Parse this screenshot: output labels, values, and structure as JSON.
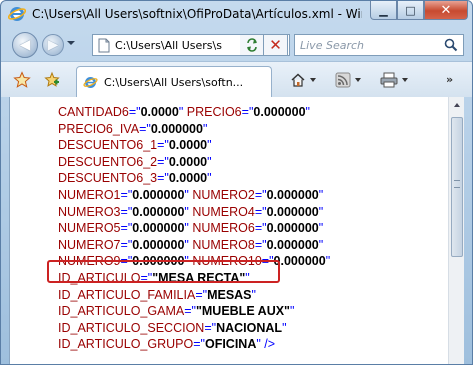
{
  "window": {
    "title": "C:\\Users\\All Users\\softnix\\OfiProData\\Artículos.xml - Windows...",
    "minimize": "▁",
    "maximize": "□",
    "close": "✕"
  },
  "nav": {
    "back": "◀",
    "forward": "▶",
    "address": "C:\\Users\\All Users\\s",
    "stop": "✕",
    "search_placeholder": "Live Search"
  },
  "tab": {
    "label": "C:\\Users\\All Users\\softn..."
  },
  "toolbar": {
    "chevron": "»"
  },
  "content": {
    "lines": [
      [
        {
          "t": "attr",
          "s": "CANTIDAD6"
        },
        {
          "t": "sym",
          "s": "=\""
        },
        {
          "t": "val",
          "s": "0.0000"
        },
        {
          "t": "sym",
          "s": "\" "
        },
        {
          "t": "attr",
          "s": "PRECIO6"
        },
        {
          "t": "sym",
          "s": "=\""
        },
        {
          "t": "val",
          "s": "0.000000"
        },
        {
          "t": "sym",
          "s": "\""
        }
      ],
      [
        {
          "t": "attr",
          "s": "PRECIO6_IVA"
        },
        {
          "t": "sym",
          "s": "=\""
        },
        {
          "t": "val",
          "s": "0.000000"
        },
        {
          "t": "sym",
          "s": "\""
        }
      ],
      [
        {
          "t": "attr",
          "s": "DESCUENTO6_1"
        },
        {
          "t": "sym",
          "s": "=\""
        },
        {
          "t": "val",
          "s": "0.0000"
        },
        {
          "t": "sym",
          "s": "\""
        }
      ],
      [
        {
          "t": "attr",
          "s": "DESCUENTO6_2"
        },
        {
          "t": "sym",
          "s": "=\""
        },
        {
          "t": "val",
          "s": "0.0000"
        },
        {
          "t": "sym",
          "s": "\""
        }
      ],
      [
        {
          "t": "attr",
          "s": "DESCUENTO6_3"
        },
        {
          "t": "sym",
          "s": "=\""
        },
        {
          "t": "val",
          "s": "0.0000"
        },
        {
          "t": "sym",
          "s": "\""
        }
      ],
      [
        {
          "t": "attr",
          "s": "NUMERO1"
        },
        {
          "t": "sym",
          "s": "=\""
        },
        {
          "t": "val",
          "s": "0.000000"
        },
        {
          "t": "sym",
          "s": "\" "
        },
        {
          "t": "attr",
          "s": "NUMERO2"
        },
        {
          "t": "sym",
          "s": "=\""
        },
        {
          "t": "val",
          "s": "0.000000"
        },
        {
          "t": "sym",
          "s": "\""
        }
      ],
      [
        {
          "t": "attr",
          "s": "NUMERO3"
        },
        {
          "t": "sym",
          "s": "=\""
        },
        {
          "t": "val",
          "s": "0.000000"
        },
        {
          "t": "sym",
          "s": "\" "
        },
        {
          "t": "attr",
          "s": "NUMERO4"
        },
        {
          "t": "sym",
          "s": "=\""
        },
        {
          "t": "val",
          "s": "0.000000"
        },
        {
          "t": "sym",
          "s": "\""
        }
      ],
      [
        {
          "t": "attr",
          "s": "NUMERO5"
        },
        {
          "t": "sym",
          "s": "=\""
        },
        {
          "t": "val",
          "s": "0.000000"
        },
        {
          "t": "sym",
          "s": "\" "
        },
        {
          "t": "attr",
          "s": "NUMERO6"
        },
        {
          "t": "sym",
          "s": "=\""
        },
        {
          "t": "val",
          "s": "0.000000"
        },
        {
          "t": "sym",
          "s": "\""
        }
      ],
      [
        {
          "t": "attr",
          "s": "NUMERO7"
        },
        {
          "t": "sym",
          "s": "=\""
        },
        {
          "t": "val",
          "s": "0.000000"
        },
        {
          "t": "sym",
          "s": "\" "
        },
        {
          "t": "attr",
          "s": "NUMERO8"
        },
        {
          "t": "sym",
          "s": "=\""
        },
        {
          "t": "val",
          "s": "0.000000"
        },
        {
          "t": "sym",
          "s": "\""
        }
      ],
      [
        {
          "t": "attr",
          "s": "NUMERO9"
        },
        {
          "t": "sym",
          "s": "=\""
        },
        {
          "t": "val",
          "s": "0.000000"
        },
        {
          "t": "sym",
          "s": "\" "
        },
        {
          "t": "attr",
          "s": "NUMERO10"
        },
        {
          "t": "sym",
          "s": "=\""
        },
        {
          "t": "val",
          "s": "0.000000"
        },
        {
          "t": "sym",
          "s": "\""
        }
      ],
      [
        {
          "t": "attr",
          "s": "ID_ARTICULO"
        },
        {
          "t": "sym",
          "s": "=\""
        },
        {
          "t": "val",
          "s": "\"MESA RECTA\""
        },
        {
          "t": "sym",
          "s": "\""
        }
      ],
      [
        {
          "t": "attr",
          "s": "ID_ARTICULO_FAMILIA"
        },
        {
          "t": "sym",
          "s": "=\""
        },
        {
          "t": "val",
          "s": "MESAS"
        },
        {
          "t": "sym",
          "s": "\""
        }
      ],
      [
        {
          "t": "attr",
          "s": "ID_ARTICULO_GAMA"
        },
        {
          "t": "sym",
          "s": "=\""
        },
        {
          "t": "val",
          "s": "\"MUEBLE AUX\""
        },
        {
          "t": "sym",
          "s": "\""
        }
      ],
      [
        {
          "t": "attr",
          "s": "ID_ARTICULO_SECCION"
        },
        {
          "t": "sym",
          "s": "=\""
        },
        {
          "t": "val",
          "s": "NACIONAL"
        },
        {
          "t": "sym",
          "s": "\""
        }
      ],
      [
        {
          "t": "attr",
          "s": "ID_ARTICULO_GRUPO"
        },
        {
          "t": "sym",
          "s": "=\""
        },
        {
          "t": "val",
          "s": "OFICINA"
        },
        {
          "t": "sym",
          "s": "\" />"
        }
      ]
    ]
  },
  "colors": {
    "attribute": "#990000",
    "value": "#000000",
    "markup": "#0000ff",
    "highlight_box": "#cc2222"
  }
}
